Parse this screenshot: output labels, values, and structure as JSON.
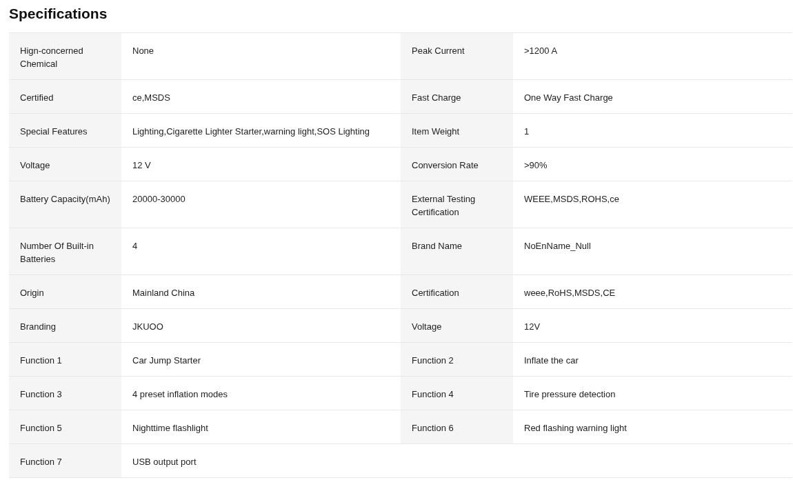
{
  "title": "Specifications",
  "rows": [
    [
      {
        "label": "Hign-concerned Chemical",
        "value": "None"
      },
      {
        "label": "Peak Current",
        "value": ">1200 A"
      }
    ],
    [
      {
        "label": "Certified",
        "value": "ce,MSDS"
      },
      {
        "label": "Fast Charge",
        "value": "One Way Fast Charge"
      }
    ],
    [
      {
        "label": "Special Features",
        "value": "Lighting,Cigarette Lighter Starter,warning light,SOS Lighting"
      },
      {
        "label": "Item Weight",
        "value": "1"
      }
    ],
    [
      {
        "label": "Voltage",
        "value": "12 V"
      },
      {
        "label": "Conversion Rate",
        "value": ">90%"
      }
    ],
    [
      {
        "label": "Battery Capacity(mAh)",
        "value": "20000-30000"
      },
      {
        "label": "External Testing Certification",
        "value": "WEEE,MSDS,ROHS,ce"
      }
    ],
    [
      {
        "label": "Number Of Built-in Batteries",
        "value": "4"
      },
      {
        "label": "Brand Name",
        "value": "NoEnName_Null"
      }
    ],
    [
      {
        "label": "Origin",
        "value": "Mainland China"
      },
      {
        "label": "Certification",
        "value": "weee,RoHS,MSDS,CE"
      }
    ],
    [
      {
        "label": "Branding",
        "value": "JKUOO"
      },
      {
        "label": "Voltage",
        "value": "12V"
      }
    ],
    [
      {
        "label": "Function 1",
        "value": "Car Jump Starter"
      },
      {
        "label": "Function 2",
        "value": "Inflate the car"
      }
    ],
    [
      {
        "label": "Function 3",
        "value": "4 preset inflation modes"
      },
      {
        "label": "Function 4",
        "value": "Tire pressure detection"
      }
    ],
    [
      {
        "label": "Function 5",
        "value": "Nighttime flashlight"
      },
      {
        "label": "Function 6",
        "value": "Red flashing warning light"
      }
    ],
    [
      {
        "label": "Function 7",
        "value": "USB output port"
      }
    ]
  ]
}
